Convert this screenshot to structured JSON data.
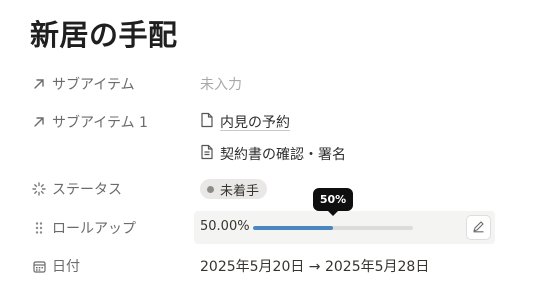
{
  "page": {
    "title": "新居の手配"
  },
  "properties": {
    "subitem": {
      "label": "サブアイテム",
      "icon": "arrow-up-right-icon",
      "placeholder": "未入力"
    },
    "subitem1": {
      "label": "サブアイテム 1",
      "icon": "arrow-up-right-icon",
      "links": [
        {
          "text": "内見の予約",
          "icon": "page-icon"
        },
        {
          "text": "契約書の確認・署名",
          "icon": "document-icon"
        }
      ]
    },
    "status": {
      "label": "ステータス",
      "icon": "status-loader-icon",
      "value": "未着手",
      "dot_color": "#8d8b88"
    },
    "rollup": {
      "label": "ロールアップ",
      "icon": "drag-handle-icon",
      "value_text": "50.00%",
      "progress": 0.5,
      "tooltip": "50%",
      "bar_color": "#4a86c0",
      "edit_icon": "edit-pencil-icon"
    },
    "date": {
      "label": "日付",
      "icon": "calendar-icon",
      "value": "2025年5月20日 → 2025年5月28日"
    }
  }
}
